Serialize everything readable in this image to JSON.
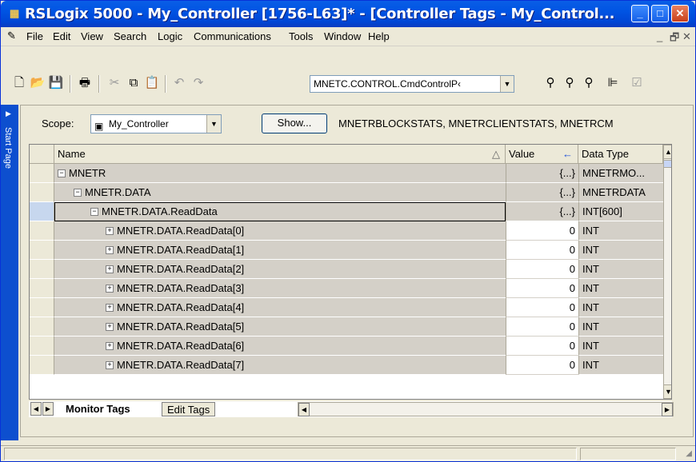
{
  "window": {
    "title": "RSLogix 5000 - My_Controller [1756-L63]* - [Controller Tags - My_Control...",
    "controls": {
      "minimize": "_",
      "maximize": "□",
      "close": "✕"
    }
  },
  "menu": {
    "items": [
      "File",
      "Edit",
      "View",
      "Search",
      "Logic",
      "Communications",
      "Tools",
      "Window",
      "Help"
    ],
    "mdi_controls": {
      "minimize": "_",
      "restore": "🗗",
      "close": "✕"
    }
  },
  "toolbar": {
    "tag_combo_value": "MNETC.CONTROL.CmdControlP‹"
  },
  "sidebar": {
    "label": "Start Page"
  },
  "scope": {
    "label": "Scope:",
    "value": "My_Controller",
    "show_button": "Show...",
    "filter_text": "MNETRBLOCKSTATS, MNETRCLIENTSTATS, MNETRCM"
  },
  "grid": {
    "columns": {
      "name": "Name",
      "sort_indicator": "△",
      "value": "Value",
      "value_indicator": "←",
      "data_type": "Data Type"
    },
    "rows": [
      {
        "expander": "−",
        "name": "MNETR",
        "value": "{...}",
        "type": "MNETRMO..."
      },
      {
        "expander": "−",
        "name": "MNETR.DATA",
        "value": "{...}",
        "type": "MNETRDATA"
      },
      {
        "expander": "−",
        "name": "MNETR.DATA.ReadData",
        "value": "{...}",
        "type": "INT[600]"
      },
      {
        "expander": "+",
        "name": "MNETR.DATA.ReadData[0]",
        "value": "0",
        "type": "INT"
      },
      {
        "expander": "+",
        "name": "MNETR.DATA.ReadData[1]",
        "value": "0",
        "type": "INT"
      },
      {
        "expander": "+",
        "name": "MNETR.DATA.ReadData[2]",
        "value": "0",
        "type": "INT"
      },
      {
        "expander": "+",
        "name": "MNETR.DATA.ReadData[3]",
        "value": "0",
        "type": "INT"
      },
      {
        "expander": "+",
        "name": "MNETR.DATA.ReadData[4]",
        "value": "0",
        "type": "INT"
      },
      {
        "expander": "+",
        "name": "MNETR.DATA.ReadData[5]",
        "value": "0",
        "type": "INT"
      },
      {
        "expander": "+",
        "name": "MNETR.DATA.ReadData[6]",
        "value": "0",
        "type": "INT"
      },
      {
        "expander": "+",
        "name": "MNETR.DATA.ReadData[7]",
        "value": "0",
        "type": "INT"
      }
    ]
  },
  "tabs": {
    "active": "Monitor Tags",
    "inactive": "Edit Tags"
  }
}
